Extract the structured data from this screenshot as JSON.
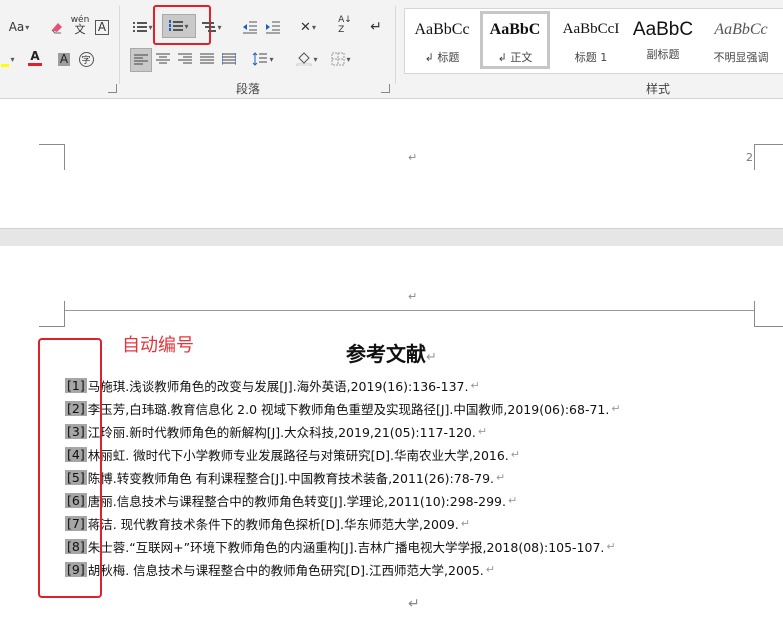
{
  "ribbon": {
    "font_controls": {
      "change_case": "Aa",
      "phonetic": "wén",
      "border_char": "A",
      "font_color": "A",
      "shade_char": "A",
      "enclose_char": "字"
    },
    "paragraph_label": "段落",
    "styles_label": "样式",
    "styles": [
      {
        "sample": "AaBbCc",
        "name": "标题",
        "mark": "↲"
      },
      {
        "sample": "AaBbC",
        "name": "正文",
        "mark": "↲"
      },
      {
        "sample": "AaBbCcI",
        "name": "标题 1",
        "mark": ""
      },
      {
        "sample": "AaBbC",
        "name": "副标题",
        "mark": ""
      },
      {
        "sample": "AaBbCc",
        "name": "不明显强调",
        "mark": ""
      }
    ],
    "accent_red": "#e0202a"
  },
  "document": {
    "page1": {
      "paragraph_mark": "↵",
      "page_number": "2"
    },
    "page2": {
      "header_mark": "↵",
      "title": "参考文献",
      "title_mark": "↵",
      "annotation": "自动编号",
      "references": [
        {
          "num": "[1]",
          "text": "马施琪.浅谈教师角色的改变与发展[J].海外英语,2019(16):136-137.",
          "mark": "↵"
        },
        {
          "num": "[2]",
          "text": "李玉芳,白玮璐.教育信息化 2.0 视域下教师角色重塑及实现路径[J].中国教师,2019(06):68-71.",
          "mark": "↵"
        },
        {
          "num": "[3]",
          "text": "江玲丽.新时代教师角色的新解构[J].大众科技,2019,21(05):117-120.",
          "mark": "↵"
        },
        {
          "num": "[4]",
          "text": "林丽虹. 微时代下小学教师专业发展路径与对策研究[D].华南农业大学,2016.",
          "mark": "↵"
        },
        {
          "num": "[5]",
          "text": "陈博.转变教师角色   有利课程整合[J].中国教育技术装备,2011(26):78-79.",
          "mark": "↵"
        },
        {
          "num": "[6]",
          "text": "唐丽.信息技术与课程整合中的教师角色转变[J].学理论,2011(10):298-299.",
          "mark": "↵"
        },
        {
          "num": "[7]",
          "text": "蒋洁. 现代教育技术条件下的教师角色探析[D].华东师范大学,2009.",
          "mark": "↵"
        },
        {
          "num": "[8]",
          "text": "朱士蓉.“互联网+”环境下教师角色的内涵重构[J].吉林广播电视大学学报,2018(08):105-107.",
          "mark": "↵"
        },
        {
          "num": "[9]",
          "text": "胡秋梅. 信息技术与课程整合中的教师角色研究[D].江西师范大学,2005.",
          "mark": "↵"
        }
      ],
      "end_mark": "↵"
    }
  }
}
